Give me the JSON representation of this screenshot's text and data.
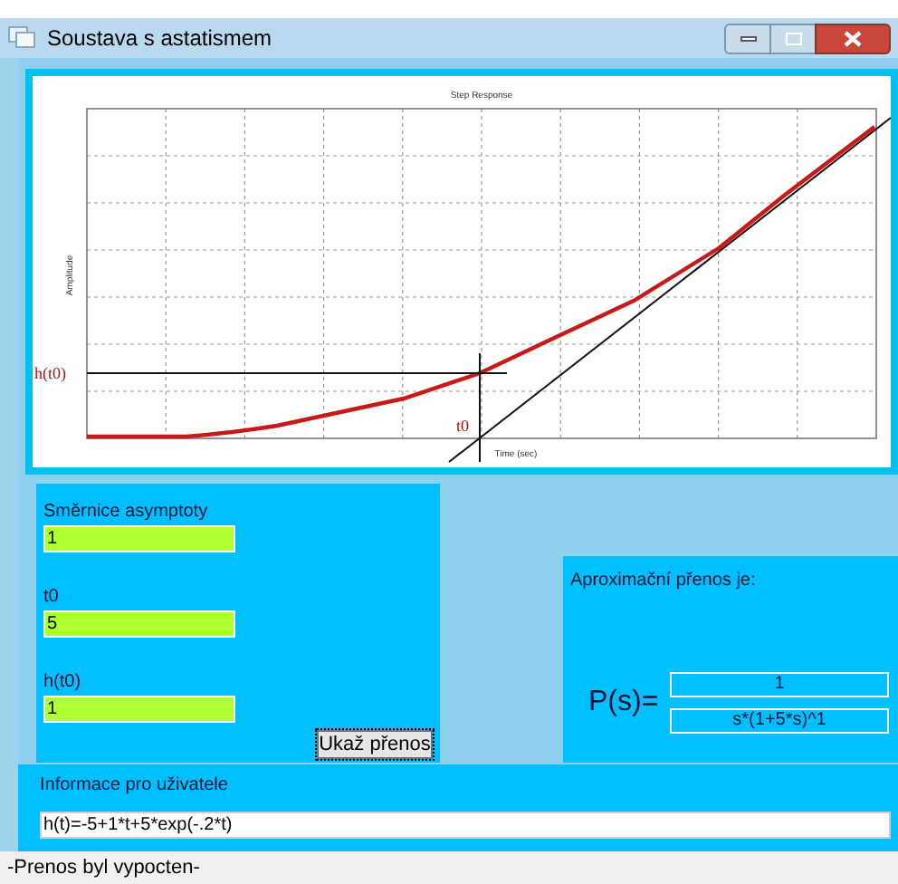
{
  "window": {
    "title": "Soustava s astatismem"
  },
  "plot": {
    "title": "Step Response",
    "ylabel": "Amplitude",
    "xlabel": "Time (sec)",
    "h_marker": "h(t0)",
    "t_marker": "t0"
  },
  "inputs": [
    {
      "label": "Směrnice asymptoty",
      "value": "1"
    },
    {
      "label": "t0",
      "value": "5"
    },
    {
      "label": "h(t0)",
      "value": "1"
    }
  ],
  "show_button": "Ukaž přenos",
  "result": {
    "heading": "Aproximační přenos je:",
    "lhs": "P(s)=",
    "numerator": "1",
    "denominator": "s*(1+5*s)^1"
  },
  "info": {
    "label": "Informace pro uživatele",
    "value": "h(t)=-5+1*t+5*exp(-.2*t)"
  },
  "status_bar": "-Prenos byl vypocten-"
}
